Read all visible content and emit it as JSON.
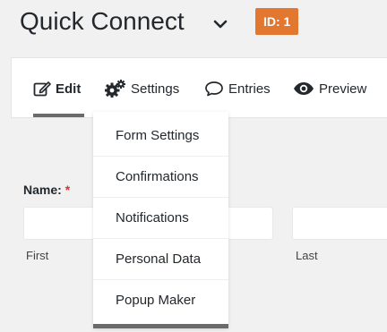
{
  "header": {
    "title": "Quick Connect",
    "id_badge": "ID: 1",
    "badge_color": "#e27730",
    "chevron_icon": "chevron-down-icon"
  },
  "toolbar": {
    "tabs": [
      {
        "label": "Edit",
        "icon": "edit-icon",
        "active": true
      },
      {
        "label": "Settings",
        "icon": "gears-icon"
      },
      {
        "label": "Entries",
        "icon": "speech-bubble-icon"
      },
      {
        "label": "Preview",
        "icon": "eye-icon"
      }
    ]
  },
  "settings_menu": {
    "items": [
      {
        "label": "Form Settings"
      },
      {
        "label": "Confirmations"
      },
      {
        "label": "Notifications"
      },
      {
        "label": "Personal Data"
      },
      {
        "label": "Popup Maker"
      }
    ]
  },
  "form": {
    "field_label": "Name:",
    "required_marker": "*",
    "required_color": "#dc3232",
    "sub_labels": {
      "first": "First",
      "last": "Last"
    }
  }
}
